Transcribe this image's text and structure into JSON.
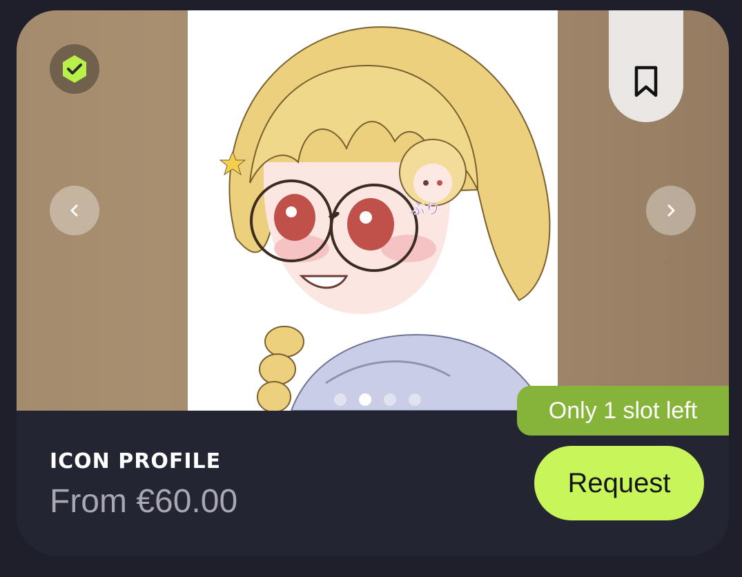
{
  "listing": {
    "title": "ICON PROFILE",
    "price": "From €60.00",
    "slot_badge": "Only 1 slot left",
    "request_label": "Request"
  },
  "gallery": {
    "art_text": "ぶり",
    "dots": 4,
    "active_dot": 1
  },
  "icons": {
    "verified": "verified-check-icon",
    "bookmark": "bookmark-icon",
    "prev": "chevron-left-icon",
    "next": "chevron-right-icon"
  },
  "colors": {
    "background": "#1e1f2b",
    "card": "#242532",
    "accent": "#c8f55a",
    "badge": "#86b33a"
  }
}
